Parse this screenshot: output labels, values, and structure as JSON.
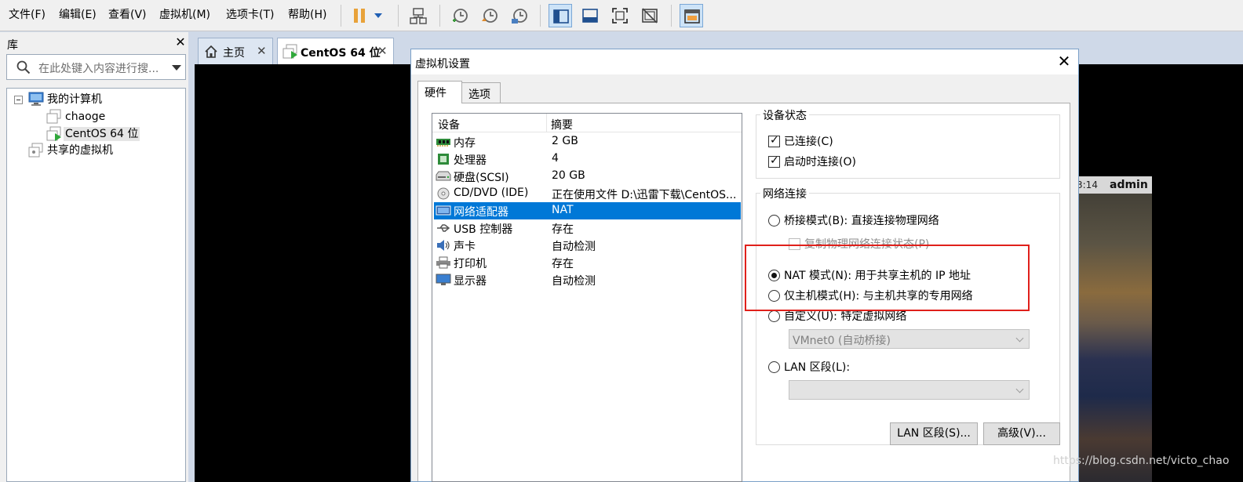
{
  "menu": {
    "file": "文件(F)",
    "edit": "编辑(E)",
    "view": "查看(V)",
    "vm": "虚拟机(M)",
    "tabs": "选项卡(T)",
    "help": "帮助(H)"
  },
  "library": {
    "title": "库",
    "close": "✕",
    "search_placeholder": "在此处键入内容进行搜...",
    "tree": {
      "my_computer": "我的计算机",
      "vm1": "chaoge",
      "vm2": "CentOS 64 位",
      "shared": "共享的虚拟机"
    }
  },
  "doc_tabs": {
    "home": "主页",
    "vm": "CentOS 64 位",
    "close": "✕"
  },
  "vm_screen": {
    "time": "3:14",
    "user": "admin"
  },
  "dialog": {
    "title": "虚拟机设置",
    "close": "✕",
    "tabs": {
      "hardware": "硬件",
      "options": "选项"
    },
    "device_list": {
      "col_device": "设备",
      "col_summary": "摘要",
      "rows": [
        {
          "name": "内存",
          "summary": "2 GB",
          "icon": "memory-icon"
        },
        {
          "name": "处理器",
          "summary": "4",
          "icon": "cpu-icon"
        },
        {
          "name": "硬盘(SCSI)",
          "summary": "20 GB",
          "icon": "hard-disk-icon"
        },
        {
          "name": "CD/DVD (IDE)",
          "summary": "正在使用文件 D:\\迅雷下载\\CentOS...",
          "icon": "cd-dvd-icon"
        },
        {
          "name": "网络适配器",
          "summary": "NAT",
          "icon": "network-adapter-icon"
        },
        {
          "name": "USB 控制器",
          "summary": "存在",
          "icon": "usb-icon"
        },
        {
          "name": "声卡",
          "summary": "自动检测",
          "icon": "sound-card-icon"
        },
        {
          "name": "打印机",
          "summary": "存在",
          "icon": "printer-icon"
        },
        {
          "name": "显示器",
          "summary": "自动检测",
          "icon": "monitor-icon"
        }
      ],
      "selected_index": 4
    },
    "device_status": {
      "label": "设备状态",
      "connected": "已连接(C)",
      "connect_at_power_on": "启动时连接(O)",
      "connected_checked": true,
      "connect_at_power_on_checked": true
    },
    "network": {
      "label": "网络连接",
      "bridged": "桥接模式(B): 直接连接物理网络",
      "replicate": "复制物理网络连接状态(P)",
      "nat": "NAT 模式(N): 用于共享主机的 IP 地址",
      "host_only": "仅主机模式(H): 与主机共享的专用网络",
      "custom": "自定义(U): 特定虚拟网络",
      "custom_value": "VMnet0 (自动桥接)",
      "lan_segment": "LAN 区段(L):",
      "lan_value": "",
      "selected": "nat"
    },
    "buttons": {
      "lan_segments": "LAN 区段(S)...",
      "advanced": "高级(V)..."
    }
  },
  "watermark": "https://blog.csdn.net/victo_chao",
  "colors": {
    "selection": "#0078d7",
    "highlight_box": "#e0201b"
  }
}
